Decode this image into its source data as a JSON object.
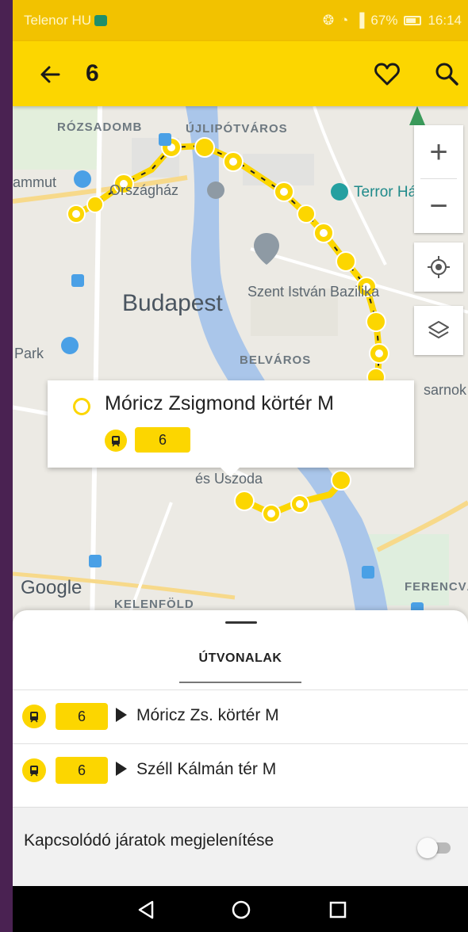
{
  "status_bar": {
    "carrier": "Telenor HU",
    "battery": "67%",
    "time": "16:14"
  },
  "app_bar": {
    "title": "6",
    "icons": [
      "back-arrow-icon",
      "heart-icon",
      "search-icon"
    ]
  },
  "map": {
    "labels": {
      "rozsadomb": "RÓZSADOMB",
      "ujlipotvaros": "ÚJLIPÓTVÁROS",
      "mammut": "ammut",
      "orszaghaz": "Országház",
      "terror": "Terror Háza",
      "budapest": "Budapest",
      "bazilika": "Szent István Bazilika",
      "park": "Park",
      "belvaros": "BELVÁROS",
      "sarnok": "sarnok",
      "uszoda": "és Uszoda",
      "google": "Google",
      "kelenfold": "KELENFÖLD",
      "ferencvaros": "FERENCVÁ"
    },
    "controls": {
      "zoom_in": "+",
      "zoom_out": "−"
    },
    "route_color": "#fcd600"
  },
  "popup": {
    "stop_name": "Móricz Zsigmond körtér M",
    "line": "6"
  },
  "sheet": {
    "tab_label": "ÚTVONALAK",
    "routes": [
      {
        "line": "6",
        "destination": "Móricz Zs. körtér M"
      },
      {
        "line": "6",
        "destination": "Széll Kálmán tér M"
      }
    ],
    "toggle_label": "Kapcsolódó járatok megjelenítése",
    "toggle_on": false
  },
  "colors": {
    "accent": "#fcd600",
    "frame": "#4a2252"
  }
}
